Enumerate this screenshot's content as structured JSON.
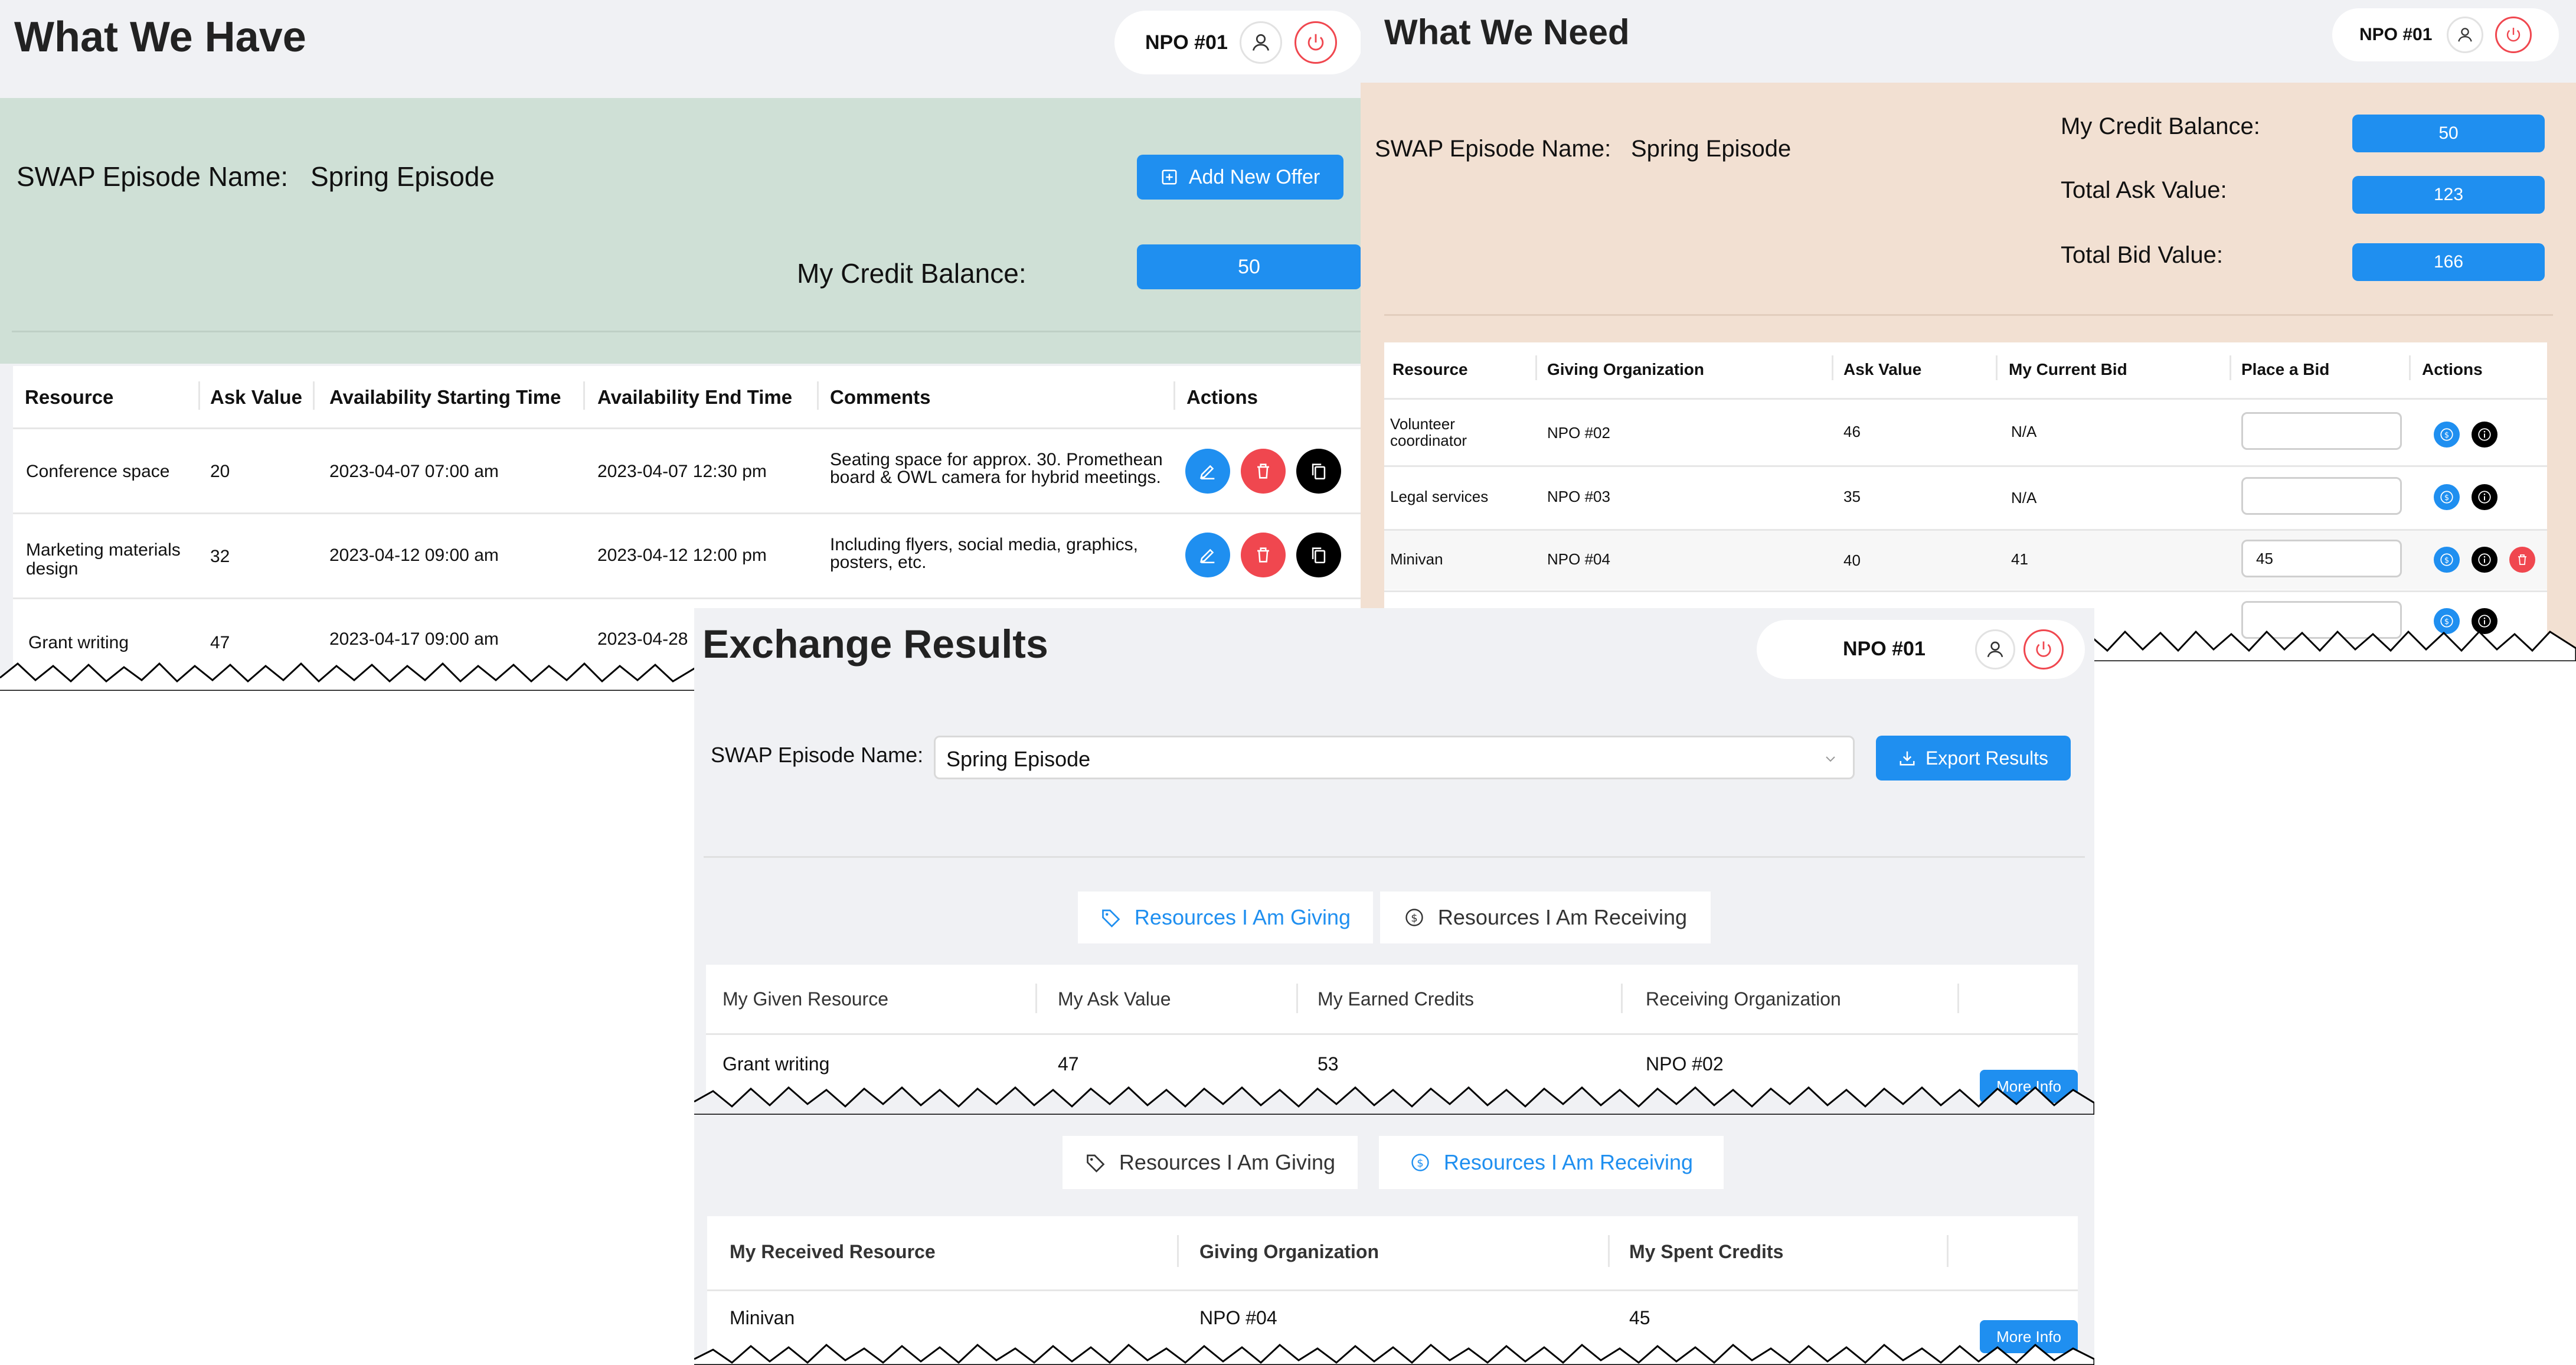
{
  "have": {
    "title": "What We Have",
    "user": "NPO #01",
    "episode_label": "SWAP Episode Name:",
    "episode_name": "Spring Episode",
    "add_offer_label": "Add New Offer",
    "credit_label": "My Credit Balance:",
    "credit_value": "50",
    "columns": [
      "Resource",
      "Ask Value",
      "Availability Starting Time",
      "Availability End Time",
      "Comments",
      "Actions"
    ],
    "rows": [
      {
        "resource": "Conference space",
        "ask": "20",
        "start": "2023-04-07 07:00 am",
        "end": "2023-04-07 12:30 pm",
        "comments": "Seating space for approx. 30. Promethean board & OWL camera for hybrid meetings."
      },
      {
        "resource": "Marketing materials design",
        "ask": "32",
        "start": "2023-04-12 09:00 am",
        "end": "2023-04-12 12:00 pm",
        "comments": "Including flyers, social media, graphics, posters, etc."
      },
      {
        "resource": "Grant writing",
        "ask": "47",
        "start": "2023-04-17 09:00 am",
        "end": "2023-04-28",
        "comments": ""
      }
    ]
  },
  "need": {
    "title": "What We Need",
    "user": "NPO #01",
    "episode_label": "SWAP Episode Name:",
    "episode_name": "Spring Episode",
    "credit_label": "My Credit Balance:",
    "credit_value": "50",
    "ask_total_label": "Total Ask Value:",
    "ask_total_value": "123",
    "bid_total_label": "Total Bid Value:",
    "bid_total_value": "166",
    "columns": [
      "Resource",
      "Giving Organization",
      "Ask Value",
      "My Current Bid",
      "Place a Bid",
      "Actions"
    ],
    "rows": [
      {
        "resource": "Volunteer coordinator",
        "org": "NPO #02",
        "ask": "46",
        "bid": "N/A",
        "input": ""
      },
      {
        "resource": "Legal services",
        "org": "NPO #03",
        "ask": "35",
        "bid": "N/A",
        "input": ""
      },
      {
        "resource": "Minivan",
        "org": "NPO #04",
        "ask": "40",
        "bid": "41",
        "input": "45"
      }
    ]
  },
  "results": {
    "title": "Exchange Results",
    "user": "NPO #01",
    "episode_label": "SWAP Episode Name:",
    "episode_select": "Spring Episode",
    "export_label": "Export Results",
    "tab_giving": "Resources I Am Giving",
    "tab_receiving": "Resources I Am Receiving",
    "giving_columns": [
      "My Given Resource",
      "My Ask Value",
      "My Earned Credits",
      "Receiving Organization"
    ],
    "giving_rows": [
      {
        "resource": "Grant writing",
        "ask": "47",
        "earned": "53",
        "org": "NPO #02",
        "more": "More Info"
      }
    ],
    "receiving_columns": [
      "My Received Resource",
      "Giving Organization",
      "My Spent Credits"
    ],
    "receiving_rows": [
      {
        "resource": "Minivan",
        "org": "NPO #04",
        "spent": "45",
        "more": "More Info"
      }
    ]
  },
  "colors": {
    "accent": "#1f8ff0",
    "danger": "#f0474f",
    "have_bg": "#cfe0d6",
    "need_bg": "#f2e0d2",
    "header_bg": "#f0f1f4"
  }
}
